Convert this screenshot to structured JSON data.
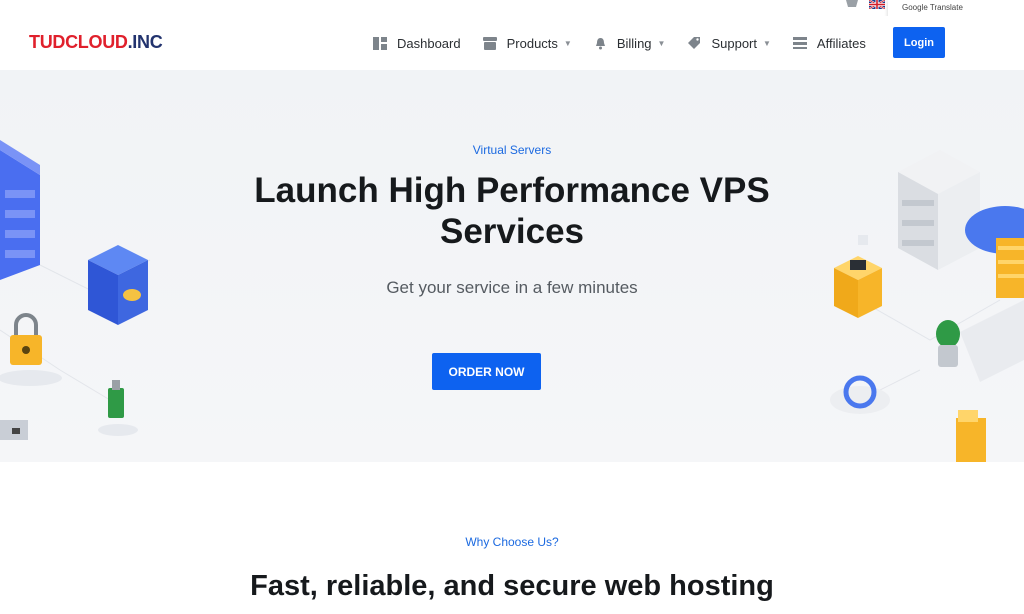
{
  "utility": {
    "translate_label": "Google Translate"
  },
  "header": {
    "logo_part1": "TUDCLOUD",
    "logo_part2": ".INC",
    "nav": [
      {
        "label": "Dashboard",
        "icon": "dashboard-icon",
        "has_caret": false
      },
      {
        "label": "Products",
        "icon": "box-icon",
        "has_caret": true
      },
      {
        "label": "Billing",
        "icon": "bell-icon",
        "has_caret": true
      },
      {
        "label": "Support",
        "icon": "tag-icon",
        "has_caret": true
      },
      {
        "label": "Affiliates",
        "icon": "list-icon",
        "has_caret": false
      }
    ],
    "login_label": "Login"
  },
  "hero": {
    "eyebrow": "Virtual Servers",
    "title": "Launch High Performance VPS Services",
    "subtitle": "Get your service in a few minutes",
    "cta_label": "ORDER NOW"
  },
  "why": {
    "eyebrow": "Why Choose Us?",
    "title": "Fast, reliable, and secure web hosting"
  },
  "colors": {
    "accent": "#0d62f0",
    "eyebrow": "#1c6ae0",
    "logo_red": "#e0202c",
    "logo_blue": "#22336e"
  }
}
